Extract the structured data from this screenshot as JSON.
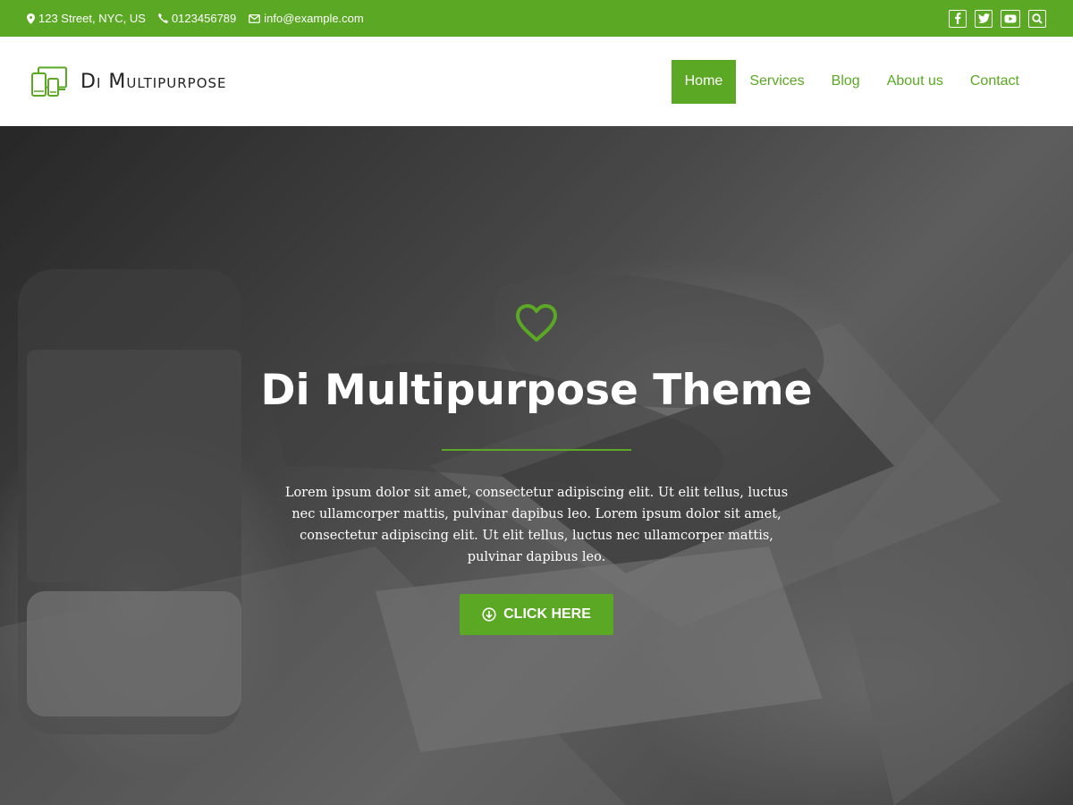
{
  "colors": {
    "accent": "#5aa823",
    "white": "#ffffff",
    "text_dark": "#222222"
  },
  "topbar": {
    "address": "123 Street, NYC, US",
    "phone": "0123456789",
    "email": "info@example.com",
    "social": [
      "facebook-icon",
      "twitter-icon",
      "youtube-icon",
      "search-icon"
    ]
  },
  "header": {
    "brand": "Di Multipurpose",
    "nav": [
      {
        "label": "Home",
        "active": true
      },
      {
        "label": "Services",
        "active": false
      },
      {
        "label": "Blog",
        "active": false
      },
      {
        "label": "About us",
        "active": false
      },
      {
        "label": "Contact",
        "active": false
      }
    ]
  },
  "hero": {
    "icon": "heart-icon",
    "title": "Di Multipurpose Theme",
    "text": "Lorem ipsum dolor sit amet, consectetur adipiscing elit. Ut elit tellus, luctus nec ullamcorper mattis, pulvinar dapibus leo. Lorem ipsum dolor sit amet, consectetur adipiscing elit. Ut elit tellus, luctus nec ullamcorper mattis, pulvinar dapibus leo.",
    "button_label": "CLICK HERE",
    "button_icon": "arrow-down-circle-icon"
  }
}
